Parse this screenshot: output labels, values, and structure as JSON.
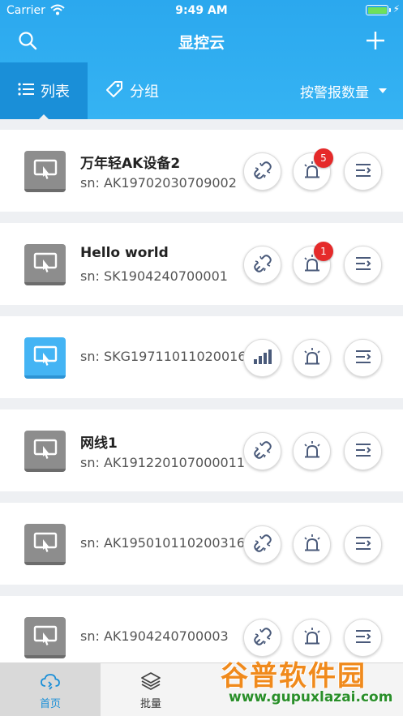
{
  "status_bar": {
    "carrier": "Carrier",
    "time": "9:49 AM"
  },
  "nav": {
    "title": "显控云"
  },
  "tabs": {
    "list_label": "列表",
    "group_label": "分组",
    "sort_label": "按警报数量"
  },
  "devices": [
    {
      "name": "万年轻AK设备2",
      "sn": "sn: AK19702030709002",
      "status": "offline",
      "alarm_count": "5"
    },
    {
      "name": "Hello world",
      "sn": "sn: SK1904240700001",
      "status": "offline",
      "alarm_count": "1"
    },
    {
      "name": "",
      "sn": "sn: SKG197110110200169",
      "status": "online",
      "alarm_count": ""
    },
    {
      "name": "网线1",
      "sn": "sn: AK191220107000011",
      "status": "offline",
      "alarm_count": ""
    },
    {
      "name": "",
      "sn": "sn: AK19501011020031616",
      "status": "offline",
      "alarm_count": ""
    },
    {
      "name": "",
      "sn": "sn: AK1904240700003",
      "status": "offline",
      "alarm_count": ""
    }
  ],
  "tabbar": {
    "home": "首页",
    "batch": "批量"
  },
  "watermark": {
    "text": "谷普软件园",
    "url": "www.gupuxlazai.com"
  },
  "colors": {
    "primary": "#2ba8ee",
    "badge": "#e52a2a",
    "online": "#44b4f4"
  }
}
